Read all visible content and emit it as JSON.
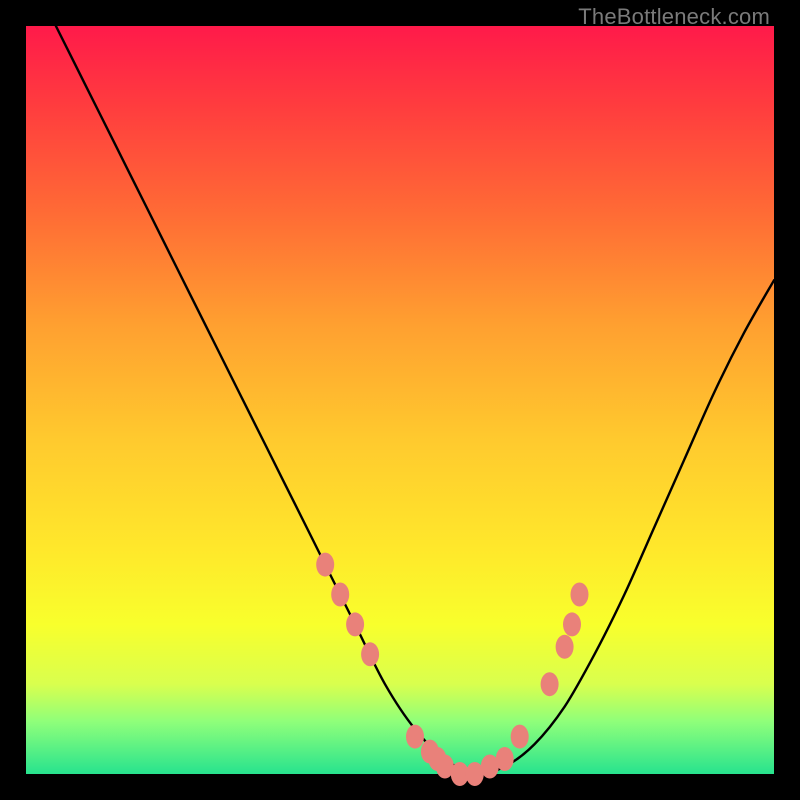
{
  "watermark": "TheBottleneck.com",
  "colors": {
    "frame": "#000000",
    "curve_stroke": "#000000",
    "marker_fill": "#e9817a",
    "marker_stroke": "#d46a63"
  },
  "chart_data": {
    "type": "line",
    "title": "",
    "xlabel": "",
    "ylabel": "",
    "xlim": [
      0,
      100
    ],
    "ylim": [
      0,
      100
    ],
    "grid": false,
    "legend": "none",
    "x": [
      4,
      8,
      12,
      16,
      20,
      24,
      28,
      32,
      36,
      40,
      44,
      48,
      52,
      56,
      60,
      64,
      68,
      72,
      76,
      80,
      84,
      88,
      92,
      96,
      100
    ],
    "values": [
      100,
      92,
      84,
      76,
      68,
      60,
      52,
      44,
      36,
      28,
      20,
      12,
      6,
      2,
      0,
      1,
      4,
      9,
      16,
      24,
      33,
      42,
      51,
      59,
      66
    ],
    "markers": {
      "x": [
        40,
        42,
        44,
        46,
        52,
        54,
        55,
        56,
        58,
        60,
        62,
        64,
        66,
        70,
        72,
        73,
        74
      ],
      "y": [
        28,
        24,
        20,
        16,
        5,
        3,
        2,
        1,
        0,
        0,
        1,
        2,
        5,
        12,
        17,
        20,
        24
      ]
    }
  }
}
